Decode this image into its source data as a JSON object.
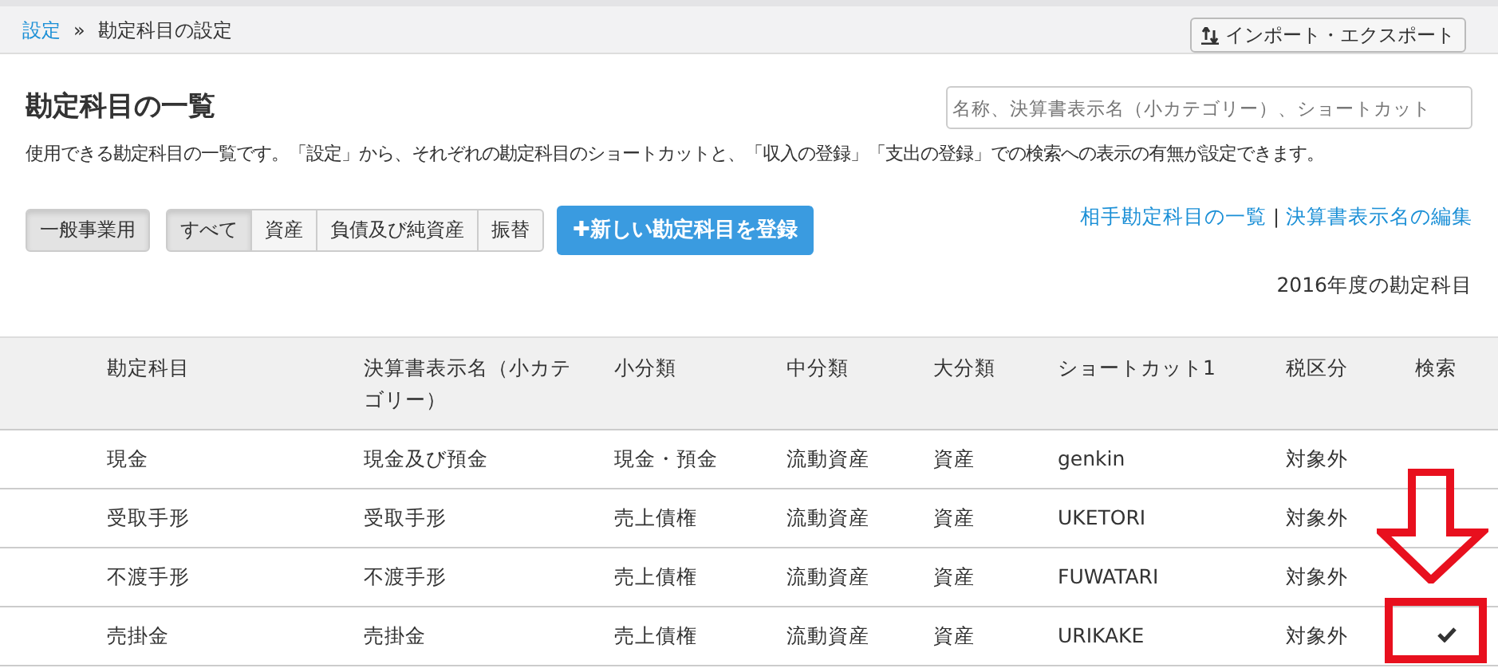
{
  "breadcrumb": [
    {
      "label": "設定",
      "link": true
    },
    {
      "label": "勘定科目の設定",
      "link": false
    }
  ],
  "breadcrumb_separator": "»",
  "import_export_button": "インポート・エクスポート",
  "title": "勘定科目の一覧",
  "search": {
    "placeholder": "名称、決算書表示名（小カテゴリー）、ショートカット"
  },
  "description": "使用できる勘定科目の一覧です。「設定」から、それぞれの勘定科目のショートカットと、「収入の登録」「支出の登録」での検索への表示の有無が設定できます。",
  "industry_button": "一般事業用",
  "filter_tabs": [
    {
      "label": "すべて",
      "selected": true
    },
    {
      "label": "資産",
      "selected": false
    },
    {
      "label": "負債及び純資産",
      "selected": false
    },
    {
      "label": "振替",
      "selected": false
    }
  ],
  "new_button": "✚新しい勘定科目を登録",
  "links": [
    "相手勘定科目の一覧",
    "決算書表示名の編集"
  ],
  "links_separator": "|",
  "year_label": "2016年度の勘定科目",
  "table": {
    "columns": [
      "勘定科目",
      "決算書表示名（小カテゴリー）",
      "小分類",
      "中分類",
      "大分類",
      "ショートカット1",
      "税区分",
      "検索"
    ],
    "rows": [
      {
        "cells": [
          "現金",
          "現金及び預金",
          "現金・預金",
          "流動資産",
          "資産",
          "genkin",
          "対象外"
        ],
        "search": false
      },
      {
        "cells": [
          "受取手形",
          "受取手形",
          "売上債権",
          "流動資産",
          "資産",
          "UKETORI",
          "対象外"
        ],
        "search": false
      },
      {
        "cells": [
          "不渡手形",
          "不渡手形",
          "売上債権",
          "流動資産",
          "資産",
          "FUWATARI",
          "対象外"
        ],
        "search": false
      },
      {
        "cells": [
          "売掛金",
          "売掛金",
          "売上債権",
          "流動資産",
          "資産",
          "URIKAKE",
          "対象外"
        ],
        "search": true
      }
    ]
  }
}
